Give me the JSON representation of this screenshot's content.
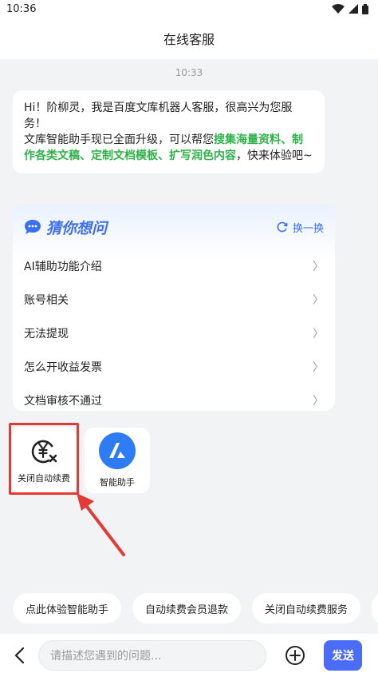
{
  "status_bar": {
    "time": "10:36"
  },
  "header": {
    "title": "在线客服"
  },
  "chat": {
    "timestamp": "10:33",
    "bot_message": {
      "line1": "Hi！阶柳灵，我是百度文库机器人客服，很高兴为您服务！",
      "line2_prefix": "文库智能助手现已全面升级，可以帮您",
      "line2_highlight": "搜集海量资料、制作各类文稿、定制文档模板、扩写润色内容",
      "line2_suffix": "，快来体验吧~"
    }
  },
  "guess": {
    "title": "猜你想问",
    "refresh_label": "换一换",
    "items": [
      {
        "label": "AI辅助功能介绍"
      },
      {
        "label": "账号相关"
      },
      {
        "label": "无法提现"
      },
      {
        "label": "怎么开收益发票"
      },
      {
        "label": "文档审核不通过"
      }
    ]
  },
  "tiles": [
    {
      "label": "关闭自动续费",
      "icon": "yen-cancel-icon"
    },
    {
      "label": "智能助手",
      "icon": "ai-assistant-icon"
    }
  ],
  "quick_chips": [
    "点此体验智能助手",
    "自动续费会员退款",
    "关闭自动续费服务"
  ],
  "input": {
    "placeholder": "请描述您遇到的问题..."
  },
  "send_label": "发送",
  "colors": {
    "accent": "#4a6cf7",
    "highlight_green": "#2fb24a",
    "annotation_red": "#e53935"
  }
}
